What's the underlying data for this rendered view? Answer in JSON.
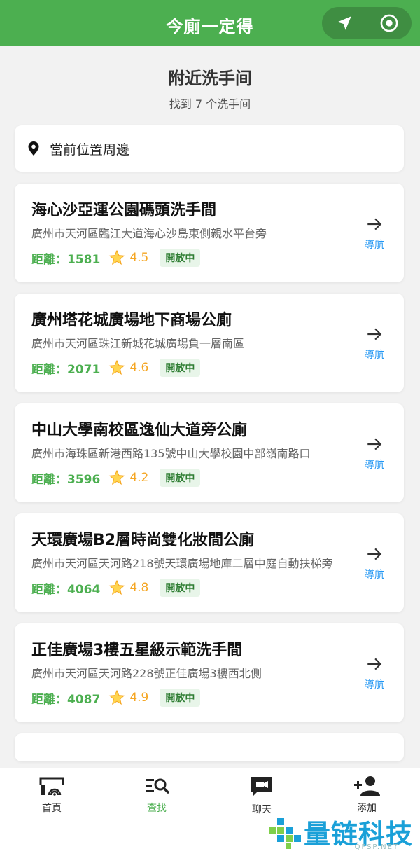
{
  "header": {
    "title": "今廁一定得",
    "icons": [
      "navigation-arrow-icon",
      "target-icon"
    ]
  },
  "page": {
    "heading": "附近洗手间",
    "subheading": "找到 7 个洗手间"
  },
  "location": {
    "label": "當前位置周邊",
    "icon": "map-pin-icon"
  },
  "toilets": [
    {
      "name": "海心沙亞運公園碼頭洗手間",
      "address": "廣州市天河區臨江大道海心沙島東側親水平台旁",
      "distance": "距離：1581",
      "rating": "4.5",
      "status": "開放中",
      "nav_label": "導航"
    },
    {
      "name": "廣州塔花城廣場地下商場公廁",
      "address": "廣州市天河區珠江新城花城廣場負一層南區",
      "distance": "距離：2071",
      "rating": "4.6",
      "status": "開放中",
      "nav_label": "導航"
    },
    {
      "name": "中山大學南校區逸仙大道旁公廁",
      "address": "廣州市海珠區新港西路135號中山大學校園中部嶺南路口",
      "distance": "距離：3596",
      "rating": "4.2",
      "status": "開放中",
      "nav_label": "導航"
    },
    {
      "name": "天環廣場B2層時尚雙化妝間公廁",
      "address": "廣州市天河區天河路218號天環廣場地庫二層中庭自動扶梯旁",
      "distance": "距離：4064",
      "rating": "4.8",
      "status": "開放中",
      "nav_label": "導航"
    },
    {
      "name": "正佳廣場3樓五星級示範洗手間",
      "address": "廣州市天河區天河路228號正佳廣場3樓西北側",
      "distance": "距離：4087",
      "rating": "4.9",
      "status": "開放中",
      "nav_label": "導航"
    }
  ],
  "tabbar": {
    "items": [
      {
        "label": "首頁",
        "icon": "home-signal-icon",
        "active": false
      },
      {
        "label": "查找",
        "icon": "search-list-icon",
        "active": true
      },
      {
        "label": "聊天",
        "icon": "chat-video-icon",
        "active": false
      },
      {
        "label": "添加",
        "icon": "add-user-icon",
        "active": false
      }
    ]
  },
  "watermark": {
    "text": "量链科技",
    "sub": "QFSP.NET"
  },
  "colors": {
    "brand_green": "#4caf50",
    "link_blue": "#2196f3",
    "rating_orange": "#f5a623"
  }
}
